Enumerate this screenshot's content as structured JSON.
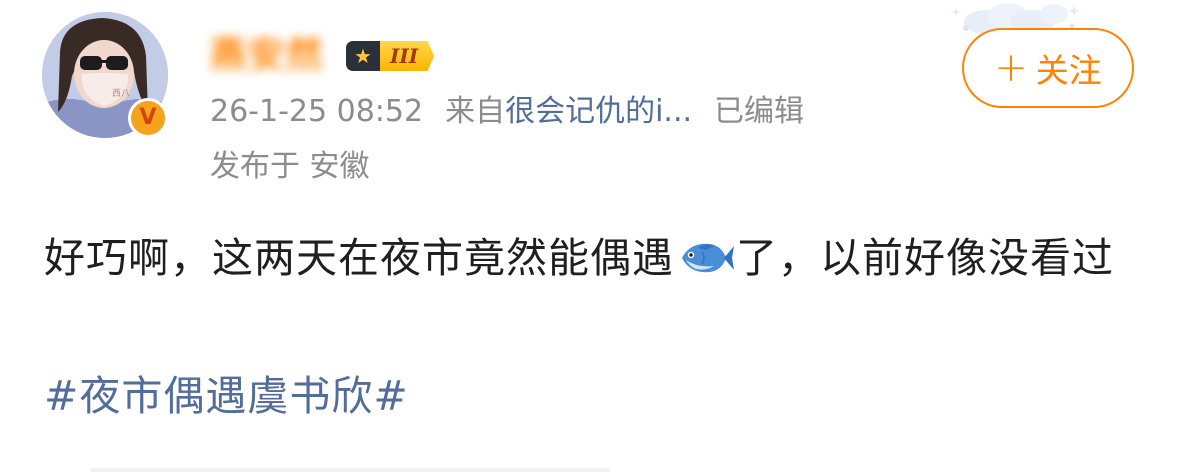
{
  "post": {
    "author": {
      "name": "燕安然",
      "level_badge": "III",
      "avatar": "avatar-photo",
      "verified": true
    },
    "follow_label": "关注",
    "follow_plus": "+",
    "timestamp": "26-1-25 08:52",
    "source_prefix": "来自",
    "source_name": "很会记仇的i...",
    "edited_label": "已编辑",
    "location_label": "发布于 安徽",
    "text_part1": "好巧啊，这两天在夜市竟然能偶遇",
    "text_emoji": "fish-icon",
    "text_part2": "了，以前好像没看过",
    "hashtag": "#夜市偶遇虞书欣#"
  },
  "colors": {
    "brand_orange": "#ff8200",
    "link_blue": "#526d9a",
    "meta_gray": "#8c8c8c",
    "text": "#1f1f1f"
  }
}
